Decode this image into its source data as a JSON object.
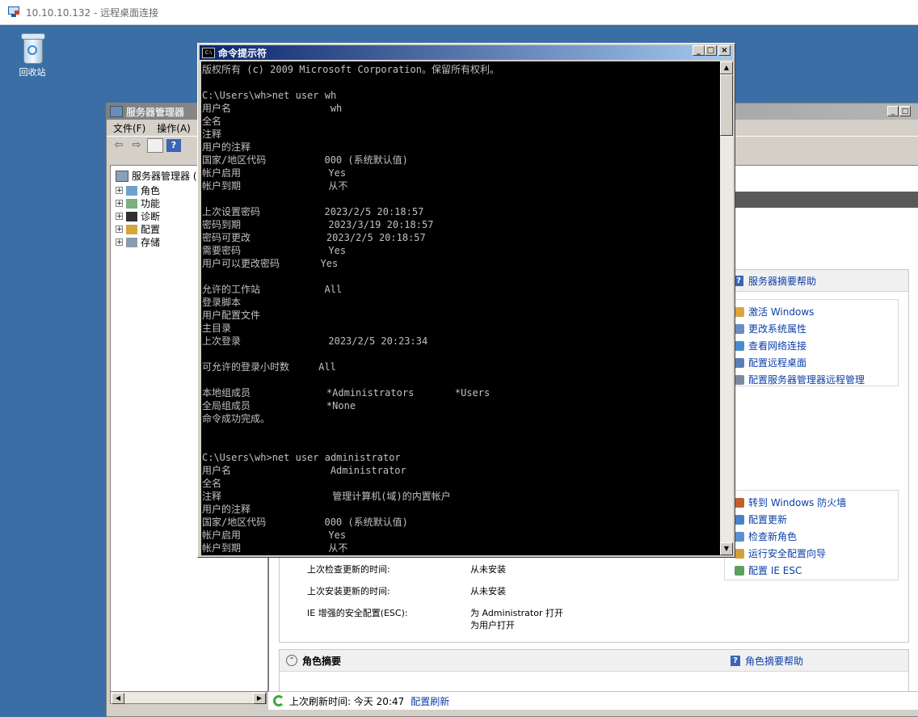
{
  "rdp": {
    "title": "10.10.10.132 - 远程桌面连接"
  },
  "desktop": {
    "recycle_label": "回收站"
  },
  "server_manager": {
    "title": "服务器管理器",
    "menu": [
      "文件(F)",
      "操作(A)"
    ],
    "tree": {
      "root": "服务器管理器 (",
      "items": [
        "角色",
        "功能",
        "诊断",
        "配置",
        "存储"
      ]
    },
    "summary_help": "服务器摘要帮助",
    "computer_links": [
      "激活 Windows",
      "更改系统属性",
      "查看网络连接",
      "配置远程桌面",
      "配置服务器管理器远程管理"
    ],
    "security_links": [
      "转到 Windows 防火墙",
      "配置更新",
      "检查新角色",
      "运行安全配置向导",
      "配置 IE ESC"
    ],
    "security_rows": [
      {
        "label": "上次检查更新的时间:",
        "value": "从未安装"
      },
      {
        "label": "上次安装更新的时间:",
        "value": "从未安装"
      },
      {
        "label": "IE 增强的安全配置(ESC):",
        "value": "为 Administrator 打开",
        "value2": "为用户打开"
      }
    ],
    "roles_title": "角色摘要",
    "roles_help": "角色摘要帮助",
    "status": {
      "text": "上次刷新时间: 今天 20:47",
      "link": "配置刷新"
    }
  },
  "cmd": {
    "title": "命令提示符",
    "text": "版权所有 (c) 2009 Microsoft Corporation。保留所有权利。\n\nC:\\Users\\wh>net user wh\n用户名                 wh\n全名\n注释\n用户的注释\n国家/地区代码          000 (系统默认值)\n帐户启用               Yes\n帐户到期               从不\n\n上次设置密码           2023/2/5 20:18:57\n密码到期               2023/3/19 20:18:57\n密码可更改             2023/2/5 20:18:57\n需要密码               Yes\n用户可以更改密码       Yes\n\n允许的工作站           All\n登录脚本\n用户配置文件\n主目录\n上次登录               2023/2/5 20:23:34\n\n可允许的登录小时数     All\n\n本地组成员             *Administrators       *Users\n全局组成员             *None\n命令成功完成。\n\n\nC:\\Users\\wh>net user administrator\n用户名                 Administrator\n全名\n注释                   管理计算机(域)的内置帐户\n用户的注释\n国家/地区代码          000 (系统默认值)\n帐户启用               Yes\n帐户到期               从不"
  }
}
